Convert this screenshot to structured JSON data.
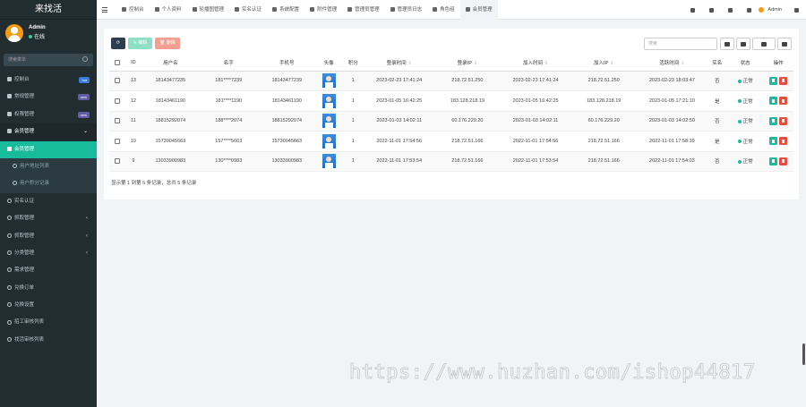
{
  "sidebar": {
    "app_title": "来找活",
    "user": {
      "name": "Admin",
      "status": "在线"
    },
    "search_placeholder": "搜索菜单",
    "menu": [
      {
        "label": "控制台",
        "badge": "hot",
        "badge_color": "#3a7bd5",
        "state": "normal"
      },
      {
        "label": "常规管理",
        "badge": "new",
        "badge_color": "#605ca8",
        "state": "normal"
      },
      {
        "label": "权限管理",
        "badge": "new",
        "badge_color": "#605ca8",
        "state": "normal"
      },
      {
        "label": "会员管理",
        "arrow": "⌄",
        "state": "open"
      },
      {
        "label": "会员管理",
        "state": "active"
      },
      {
        "label": "用户地址列表",
        "state": "sub"
      },
      {
        "label": "用户积分记录",
        "state": "sub"
      },
      {
        "label": "实名认证",
        "state": "normal"
      },
      {
        "label": "抓取管理",
        "arrow": "‹",
        "state": "normal"
      },
      {
        "label": "抓取管理",
        "arrow": "‹",
        "state": "normal"
      },
      {
        "label": "分类管理",
        "arrow": "‹",
        "state": "normal"
      },
      {
        "label": "需求管理",
        "state": "normal"
      },
      {
        "label": "兑换订单",
        "state": "normal"
      },
      {
        "label": "兑换设置",
        "state": "normal"
      },
      {
        "label": "招工审核列表",
        "state": "normal"
      },
      {
        "label": "找活审核列表",
        "state": "normal"
      }
    ]
  },
  "topbar": {
    "tabs": [
      "控制台",
      "个人资料",
      "轮播图管理",
      "实名认证",
      "系统配置",
      "附件管理",
      "管理员管理",
      "管理员日志",
      "角色组",
      "会员管理"
    ],
    "active_tab": 9,
    "admin_label": "Admin"
  },
  "toolbar": {
    "edit_label": "编辑",
    "delete_label": "删除",
    "search_placeholder": "搜索"
  },
  "table": {
    "headers": [
      "ID",
      "用户名",
      "名字",
      "手机号",
      "头像",
      "积分",
      "登录时间",
      "登录IP",
      "加入时间",
      "加入IP",
      "活跃时间",
      "实名",
      "状态",
      "操作"
    ],
    "rows": [
      {
        "id": "13",
        "username": "18143477235",
        "name": "181****7239",
        "phone": "18143477239",
        "score": "1",
        "login_time": "2023-02-23 17:41:24",
        "login_ip": "218.72.51.250",
        "join_time": "2023-02-23 17:41:24",
        "join_ip": "218.72.51.250",
        "active_time": "2023-02-23 18:03:47",
        "realname": "否",
        "status": "正常"
      },
      {
        "id": "12",
        "username": "18143461190",
        "name": "181****1190",
        "phone": "18143461190",
        "score": "1",
        "login_time": "2023-01-05 16:42:25",
        "login_ip": "183.128.218.19",
        "join_time": "2023-01-05 16:42:25",
        "join_ip": "183.128.218.19",
        "active_time": "2023-01-05 17:21:10",
        "realname": "是",
        "status": "正常"
      },
      {
        "id": "11",
        "username": "18815292074",
        "name": "188****2074",
        "phone": "18815292074",
        "score": "1",
        "login_time": "2023-01-03 14:02:11",
        "login_ip": "60.176.229.20",
        "join_time": "2023-01-03 14:02:11",
        "join_ip": "60.176.229.20",
        "active_time": "2023-01-03 14:02:50",
        "realname": "否",
        "status": "正常"
      },
      {
        "id": "10",
        "username": "15730045663",
        "name": "157****5663",
        "phone": "15730045663",
        "score": "1",
        "login_time": "2022-11-01 17:54:56",
        "login_ip": "218.72.51.166",
        "join_time": "2022-11-01 17:54:56",
        "join_ip": "218.72.51.166",
        "active_time": "2022-11-01 17:58:39",
        "realname": "是",
        "status": "正常"
      },
      {
        "id": "9",
        "username": "13033900983",
        "name": "130****0983",
        "phone": "13033900983",
        "score": "1",
        "login_time": "2022-11-01 17:53:54",
        "login_ip": "218.72.51.166",
        "join_time": "2022-11-01 17:53:54",
        "join_ip": "218.72.51.166",
        "active_time": "2022-11-01 17:54:03",
        "realname": "否",
        "status": "正常"
      }
    ],
    "summary": "显示第 1 到第 5 条记录，总共 5 条记录"
  },
  "watermark": "https://www.huzhan.com/ishop44817",
  "colors": {
    "sidebar_bg": "#222d32",
    "accent": "#18bc9c",
    "danger": "#e74c3c",
    "link": "#3a7bc8"
  }
}
